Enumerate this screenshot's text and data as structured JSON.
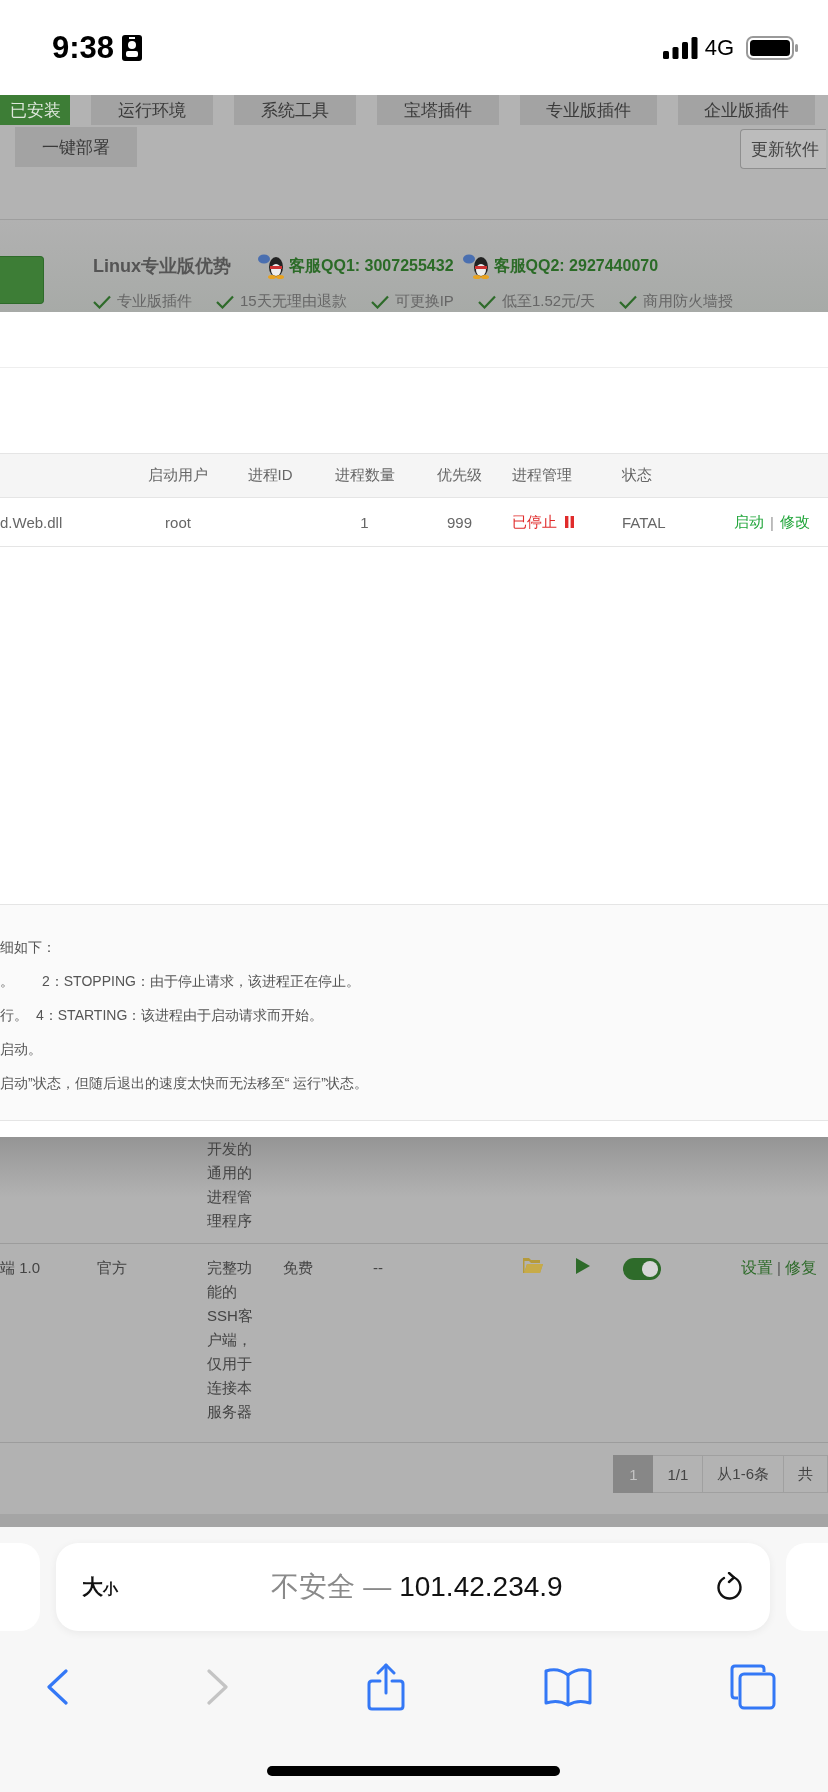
{
  "status_bar": {
    "time": "9:38",
    "network": "4G"
  },
  "plugin_tabs": [
    {
      "label": "已安装",
      "selected": true
    },
    {
      "label": "运行环境",
      "selected": false
    },
    {
      "label": "系统工具",
      "selected": false
    },
    {
      "label": "宝塔插件",
      "selected": false
    },
    {
      "label": "专业版插件",
      "selected": false
    },
    {
      "label": "企业版插件",
      "selected": false
    }
  ],
  "deploy_button": "一键部署",
  "update_button": "更新软件",
  "promo": {
    "title": "Linux专业版优势",
    "contacts": [
      "客服QQ1: 3007255432",
      "客服QQ2: 2927440070"
    ],
    "features": [
      "专业版插件",
      "15天无理由退款",
      "可更换IP",
      "低至1.52元/天",
      "商用防火墙授"
    ]
  },
  "dialog": {
    "table": {
      "columns": [
        "启动用户",
        "进程ID",
        "进程数量",
        "优先级",
        "进程管理",
        "状态"
      ],
      "rows": [
        {
          "column_1": "d.Web.dll",
          "user": "root",
          "count": "1",
          "priority": "999",
          "process_state": "已停止",
          "running": false,
          "status": "FATAL",
          "actions": [
            "启动",
            "修改"
          ],
          "separator": "|"
        }
      ]
    },
    "notes": [
      [
        "细如下："
      ],
      [
        "。",
        "2：STOPPING：由于停止请求，该进程正在停止。"
      ],
      [
        "行。",
        "4：STARTING：该进程由于启动请求而开始。"
      ],
      [
        "启动。"
      ],
      [
        "启动”状态，但随后退出的速度太快而无法移至“ 运行”状态。"
      ]
    ]
  },
  "software_table": {
    "rows": [
      {
        "column_3": "开发的通用的进程管理程序"
      },
      {
        "column_1": "端 1.0",
        "column_2": "官方",
        "column_3": "完整功能的SSH客户端，仅用于连接本服务器",
        "column_4": "免费",
        "column_5": "--",
        "on": true,
        "actions": [
          "设置",
          "修复"
        ],
        "separator": "|"
      }
    ]
  },
  "pagination": [
    {
      "label": "1",
      "selected": true
    },
    {
      "label": "1/1",
      "selected": false
    },
    {
      "label": "从1-6条",
      "selected": false
    },
    {
      "label": "共",
      "selected": false
    }
  ],
  "browser": {
    "format_button": {
      "large": "大",
      "small": "小"
    },
    "security": "不安全 —",
    "address": "101.42.234.9",
    "back_enabled": true,
    "forward_enabled": false
  }
}
